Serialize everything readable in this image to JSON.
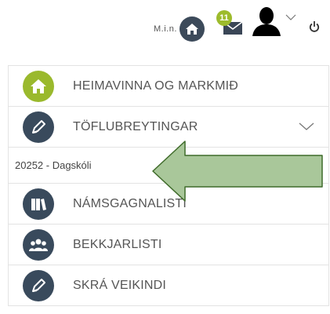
{
  "header": {
    "min_label": "M.i.n.",
    "notification_count": "11",
    "icons": {
      "home": "home-icon",
      "mail": "mail-icon",
      "user": "user-icon",
      "chevron": "chevron-down-icon",
      "power": "power-icon"
    }
  },
  "menu": {
    "items": [
      {
        "label": "HEIMAVINNA OG MARKMIÐ",
        "icon": "home-icon",
        "color": "#9ab92d"
      },
      {
        "label": "TÖFLUBREYTINGAR",
        "icon": "pencil-icon",
        "color": "#394a5c",
        "expanded": true
      },
      {
        "label": "NÁMSGAGNALISTI",
        "icon": "books-icon",
        "color": "#394a5c"
      },
      {
        "label": "BEKKJARLISTI",
        "icon": "group-icon",
        "color": "#394a5c"
      },
      {
        "label": "SKRÁ VEIKINDI",
        "icon": "pencil-icon",
        "color": "#394a5c"
      }
    ],
    "submenu": {
      "label": "20252 - Dagskóli"
    }
  },
  "colors": {
    "accent_green": "#9ab92d",
    "dark_icon": "#394a5c",
    "arrow_fill": "#a9c79a",
    "arrow_stroke": "#3f6b2a"
  }
}
